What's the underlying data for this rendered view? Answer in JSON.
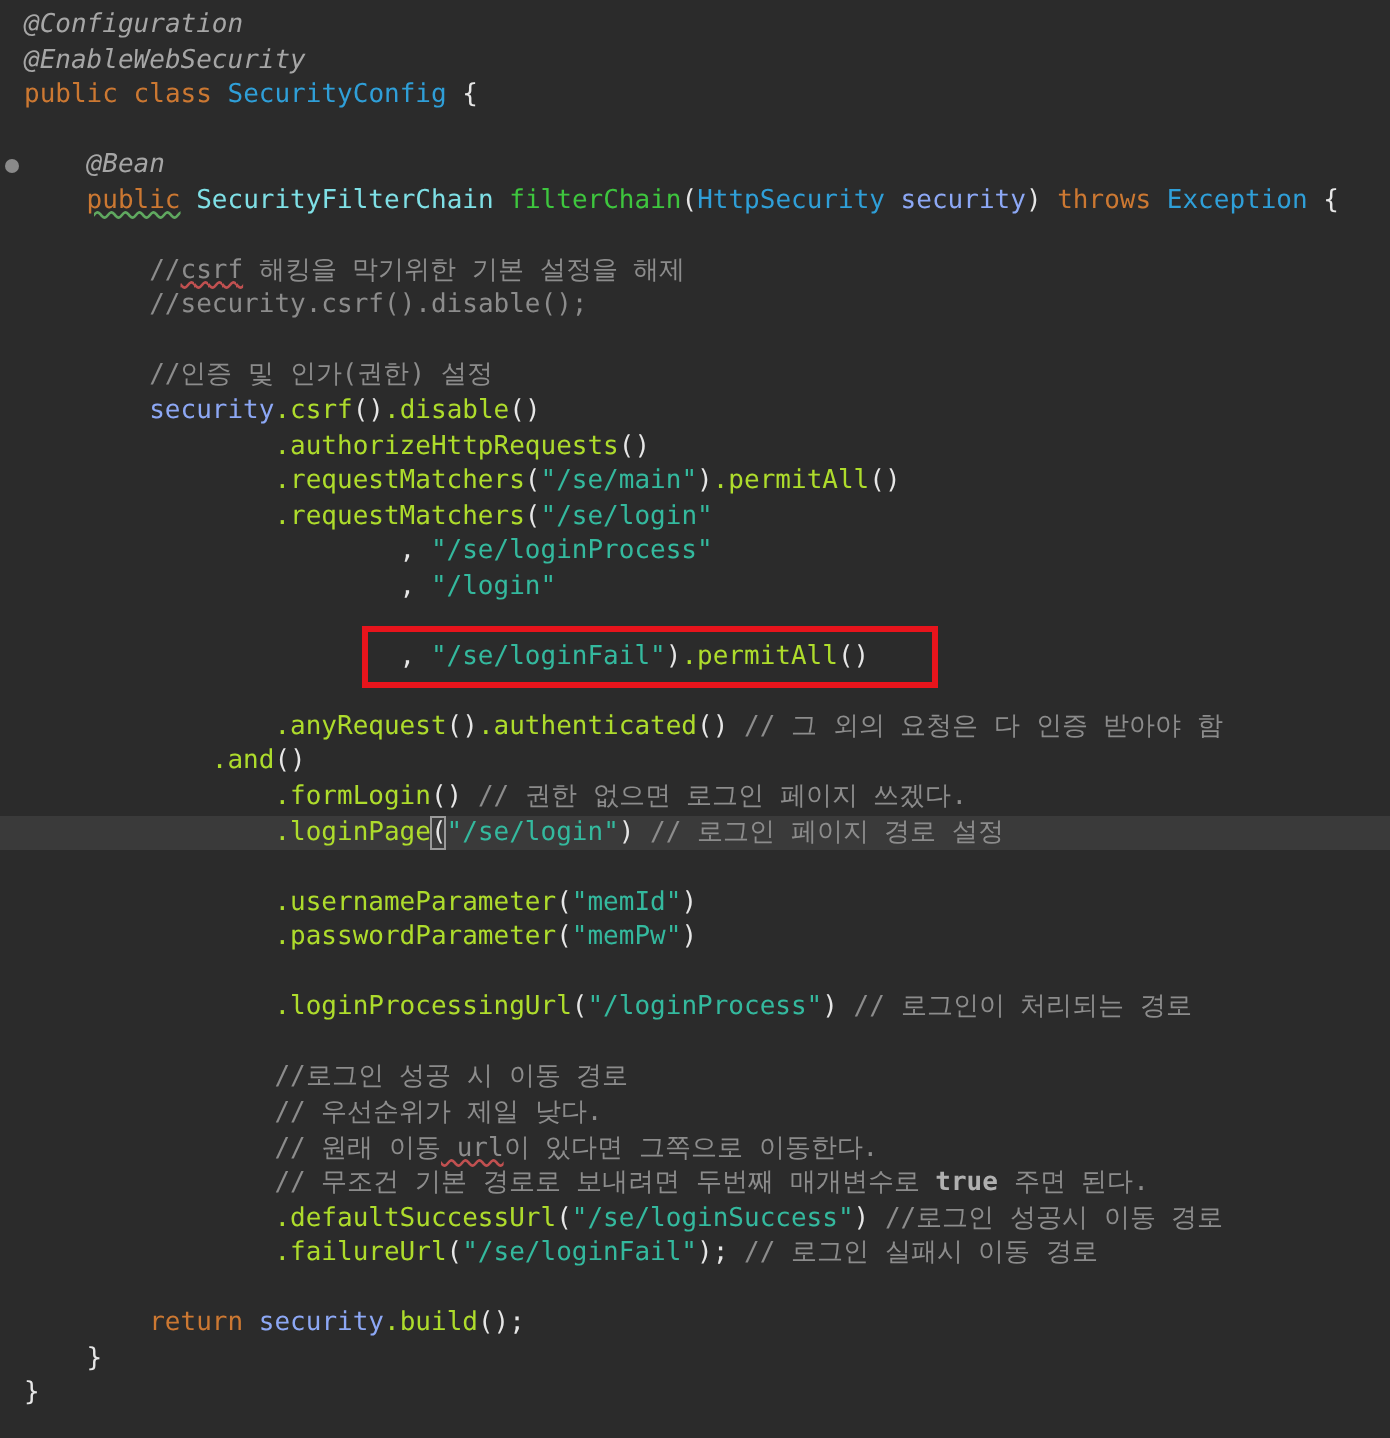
{
  "editor": {
    "lines": [
      {
        "kind": "outer",
        "tokens": [
          {
            "kind": "annotation",
            "text": "@Configuration"
          }
        ]
      },
      {
        "kind": "outer",
        "tokens": [
          {
            "kind": "annotation",
            "text": "@EnableWebSecurity"
          }
        ]
      },
      {
        "kind": "outer",
        "tokens": [
          {
            "kind": "keyword",
            "text": "public class"
          },
          {
            "kind": "type",
            "text": " SecurityConfig"
          },
          {
            "kind": "plain",
            "text": " {"
          }
        ]
      },
      {
        "kind": "blank"
      },
      {
        "kind": "member",
        "gutter_icon": true,
        "tokens": [
          {
            "kind": "annotation",
            "text": "@Bean"
          }
        ]
      },
      {
        "kind": "member",
        "tokens": [
          {
            "kind": "keyword",
            "text": "public",
            "warning": true
          },
          {
            "kind": "type2",
            "text": " SecurityFilterChain"
          },
          {
            "kind": "decl",
            "text": " filterChain"
          },
          {
            "kind": "plain",
            "text": "("
          },
          {
            "kind": "type",
            "text": "HttpSecurity"
          },
          {
            "kind": "var",
            "text": " security"
          },
          {
            "kind": "plain",
            "text": ")"
          },
          {
            "kind": "keyword",
            "text": " throws"
          },
          {
            "kind": "type",
            "text": " Exception"
          },
          {
            "kind": "plain",
            "text": " {"
          }
        ]
      },
      {
        "kind": "blank"
      },
      {
        "kind": "body",
        "tokens": [
          {
            "kind": "comment",
            "text": "//"
          },
          {
            "kind": "comment",
            "text": "csrf",
            "misspelled": true
          },
          {
            "kind": "comment",
            "text": " 해킹을 막기위한 기본 설정을 해제"
          }
        ]
      },
      {
        "kind": "body",
        "tokens": [
          {
            "kind": "comment",
            "text": "//security.csrf().disable();"
          }
        ]
      },
      {
        "kind": "blank"
      },
      {
        "kind": "body",
        "tokens": [
          {
            "kind": "comment",
            "text": "//인증 및 인가(권한) 설정"
          }
        ]
      },
      {
        "kind": "body",
        "tokens": [
          {
            "kind": "var",
            "text": "security"
          },
          {
            "kind": "method",
            "text": ".csrf"
          },
          {
            "kind": "plain",
            "text": "()"
          },
          {
            "kind": "method",
            "text": ".disable"
          },
          {
            "kind": "plain",
            "text": "()"
          }
        ]
      },
      {
        "kind": "call",
        "tokens": [
          {
            "kind": "method",
            "text": ".authorizeHttpRequests"
          },
          {
            "kind": "plain",
            "text": "()"
          }
        ]
      },
      {
        "kind": "call",
        "tokens": [
          {
            "kind": "method",
            "text": ".requestMatchers"
          },
          {
            "kind": "plain",
            "text": "("
          },
          {
            "kind": "string",
            "text": "\"/se/main\""
          },
          {
            "kind": "plain",
            "text": ")"
          },
          {
            "kind": "method",
            "text": ".permitAll"
          },
          {
            "kind": "plain",
            "text": "()"
          }
        ]
      },
      {
        "kind": "call",
        "tokens": [
          {
            "kind": "method",
            "text": ".requestMatchers"
          },
          {
            "kind": "plain",
            "text": "("
          },
          {
            "kind": "string",
            "text": "\"/se/login\""
          }
        ]
      },
      {
        "kind": "arg",
        "tokens": [
          {
            "kind": "plain",
            "text": ","
          },
          {
            "kind": "string",
            "text": " \"/se/loginProcess\""
          }
        ]
      },
      {
        "kind": "arg",
        "tokens": [
          {
            "kind": "plain",
            "text": ","
          },
          {
            "kind": "string",
            "text": " \"/login\""
          }
        ]
      },
      {
        "kind": "blank"
      },
      {
        "kind": "arg",
        "highlighted": true,
        "tokens": [
          {
            "kind": "plain",
            "text": ","
          },
          {
            "kind": "string",
            "text": " \"/se/loginFail\""
          },
          {
            "kind": "plain",
            "text": ")"
          },
          {
            "kind": "method",
            "text": ".permitAll"
          },
          {
            "kind": "plain",
            "text": "()"
          }
        ]
      },
      {
        "kind": "blank"
      },
      {
        "kind": "call",
        "tokens": [
          {
            "kind": "method",
            "text": ".anyRequest"
          },
          {
            "kind": "plain",
            "text": "()"
          },
          {
            "kind": "method",
            "text": ".authenticated"
          },
          {
            "kind": "plain",
            "text": "()"
          },
          {
            "kind": "comment",
            "text": " // 그 외의 요청은 다 인증 받아야 함"
          }
        ]
      },
      {
        "kind": "wrap",
        "tokens": [
          {
            "kind": "method",
            "text": ".and"
          },
          {
            "kind": "plain",
            "text": "()"
          }
        ]
      },
      {
        "kind": "call",
        "tokens": [
          {
            "kind": "method",
            "text": ".formLogin"
          },
          {
            "kind": "plain",
            "text": "()"
          },
          {
            "kind": "comment",
            "text": " // 권한 없으면 로그인 페이지 쓰겠다."
          }
        ]
      },
      {
        "kind": "call",
        "current": true,
        "tokens": [
          {
            "kind": "method",
            "text": ".loginPage"
          },
          {
            "kind": "plain",
            "text": "(",
            "matched": true
          },
          {
            "kind": "string",
            "text": "\"/se/login\""
          },
          {
            "kind": "plain",
            "text": ")"
          },
          {
            "kind": "comment",
            "text": " // 로그인 페이지 경로 설정"
          }
        ]
      },
      {
        "kind": "blank"
      },
      {
        "kind": "call",
        "tokens": [
          {
            "kind": "method",
            "text": ".usernameParameter"
          },
          {
            "kind": "plain",
            "text": "("
          },
          {
            "kind": "string",
            "text": "\"memId\""
          },
          {
            "kind": "plain",
            "text": ")"
          }
        ]
      },
      {
        "kind": "call",
        "tokens": [
          {
            "kind": "method",
            "text": ".passwordParameter"
          },
          {
            "kind": "plain",
            "text": "("
          },
          {
            "kind": "string",
            "text": "\"memPw\""
          },
          {
            "kind": "plain",
            "text": ")"
          }
        ]
      },
      {
        "kind": "blank"
      },
      {
        "kind": "call",
        "tokens": [
          {
            "kind": "method",
            "text": ".loginProcessingUrl"
          },
          {
            "kind": "plain",
            "text": "("
          },
          {
            "kind": "string",
            "text": "\"/loginProcess\""
          },
          {
            "kind": "plain",
            "text": ")"
          },
          {
            "kind": "comment",
            "text": " // 로그인이 처리되는 경로"
          }
        ]
      },
      {
        "kind": "blank"
      },
      {
        "kind": "call",
        "tokens": [
          {
            "kind": "comment",
            "text": "//로그인 성공 시 이동 경로"
          }
        ]
      },
      {
        "kind": "call",
        "tokens": [
          {
            "kind": "comment",
            "text": "// 우선순위가 제일 낮다."
          }
        ]
      },
      {
        "kind": "call",
        "tokens": [
          {
            "kind": "comment",
            "text": "// 원래 이동"
          },
          {
            "kind": "comment",
            "text": " url",
            "misspelled": true
          },
          {
            "kind": "comment",
            "text": "이 있다면 그쪽으로 이동한다."
          }
        ]
      },
      {
        "kind": "call",
        "tokens": [
          {
            "kind": "comment",
            "text": "// 무조건 기본 경로로 보내려면 두번째 매개변수로"
          },
          {
            "kind": "comment_bold",
            "text": " true"
          },
          {
            "kind": "comment",
            "text": " 주면 된다."
          }
        ]
      },
      {
        "kind": "call",
        "tokens": [
          {
            "kind": "method",
            "text": ".defaultSuccessUrl"
          },
          {
            "kind": "plain",
            "text": "("
          },
          {
            "kind": "string",
            "text": "\"/se/loginSuccess\""
          },
          {
            "kind": "plain",
            "text": ")"
          },
          {
            "kind": "comment",
            "text": " //로그인 성공시 이동 경로"
          }
        ]
      },
      {
        "kind": "call",
        "tokens": [
          {
            "kind": "method",
            "text": ".failureUrl"
          },
          {
            "kind": "plain",
            "text": "("
          },
          {
            "kind": "string",
            "text": "\"/se/loginFail\""
          },
          {
            "kind": "plain",
            "text": ");"
          },
          {
            "kind": "comment",
            "text": " // 로그인 실패시 이동 경로"
          }
        ]
      },
      {
        "kind": "blank"
      },
      {
        "kind": "body",
        "tokens": [
          {
            "kind": "keyword",
            "text": "return"
          },
          {
            "kind": "var",
            "text": " security"
          },
          {
            "kind": "method",
            "text": ".build"
          },
          {
            "kind": "plain",
            "text": "();"
          }
        ]
      },
      {
        "kind": "member",
        "tokens": [
          {
            "kind": "plain",
            "text": "}"
          }
        ]
      },
      {
        "kind": "outer",
        "tokens": [
          {
            "kind": "plain",
            "text": "}"
          }
        ]
      }
    ]
  }
}
